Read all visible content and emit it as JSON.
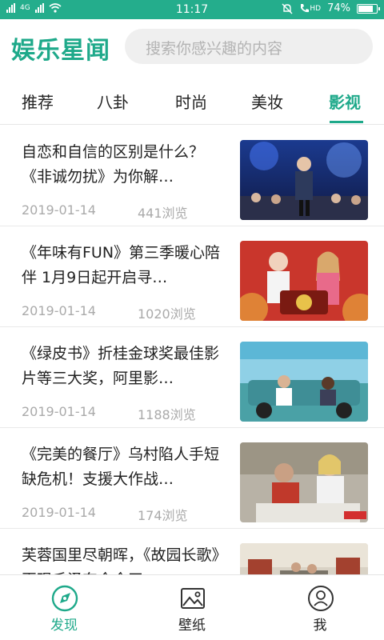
{
  "colors": {
    "accent": "#1ea98a",
    "status_bar": "#24ad8c"
  },
  "status_bar": {
    "network_left": "4G",
    "time": "11:17",
    "volte": "HD",
    "battery": "74%",
    "battery_level": 0.74
  },
  "header": {
    "app_title": "娱乐星闻",
    "search_placeholder": "搜索你感兴趣的内容"
  },
  "tabs": [
    {
      "label": "推荐"
    },
    {
      "label": "八卦"
    },
    {
      "label": "时尚"
    },
    {
      "label": "美妆"
    },
    {
      "label": "影视",
      "active": true
    }
  ],
  "articles": [
    {
      "title": "自恋和自信的区别是什么？《非诚勿扰》为你解…",
      "date": "2019-01-14",
      "views": "441浏览"
    },
    {
      "title": "《年味有FUN》第三季暖心陪伴 1月9日起开启寻…",
      "date": "2019-01-14",
      "views": "1020浏览"
    },
    {
      "title": "《绿皮书》折桂金球奖最佳影片等三大奖，阿里影…",
      "date": "2019-01-14",
      "views": "1188浏览"
    },
    {
      "title": "《完美的餐厅》乌村陷人手短缺危机！支援大作战…",
      "date": "2019-01-14",
      "views": "174浏览"
    },
    {
      "title": "芙蓉国里尽朝晖，《故园长歌》再现毛泽东今今天…",
      "date": "",
      "views": ""
    }
  ],
  "bottom_nav": [
    {
      "label": "发现",
      "icon": "discover-icon",
      "active": true
    },
    {
      "label": "壁纸",
      "icon": "wallpaper-icon"
    },
    {
      "label": "我",
      "icon": "profile-icon"
    }
  ]
}
